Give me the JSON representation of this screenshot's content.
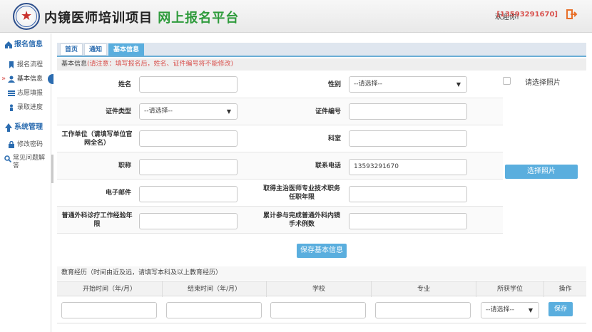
{
  "header": {
    "title_main": "内镜医师培训项目",
    "title_highlight": "网上报名平台",
    "welcome": "欢迎你!",
    "phone": "[13593291670]"
  },
  "sidebar": {
    "group1": "报名信息",
    "items1": [
      "报名流程",
      "基本信息",
      "志愿填报",
      "录取进度"
    ],
    "group2": "系统管理",
    "items2": [
      "修改密码",
      "常见问题解答"
    ]
  },
  "tabs": [
    "首页",
    "通知",
    "基本信息"
  ],
  "basic": {
    "heading": "基本信息",
    "note": "(请注意：填写报名后，姓名、证件编号将不能修改)",
    "name_label": "姓名",
    "gender_label": "性别",
    "gender_value": "--请选择--",
    "idtype_label": "证件类型",
    "idtype_value": "--请选择--",
    "idno_label": "证件编号",
    "unit_label": "工作单位（请填写单位官网全名）",
    "dept_label": "科室",
    "title_label": "职称",
    "phone_label": "联系电话",
    "phone_value": "13593291670",
    "email_label": "电子邮件",
    "years_label": "取得主治医师专业技术职务任职年限",
    "exp_label": "普通外科诊疗工作经验年限",
    "count_label": "累计参与完成普通外科内镜手术例数",
    "photo_check_label": "请选择照片",
    "photo_button": "选择照片",
    "save_button": "保存基本信息"
  },
  "education": {
    "heading": "教育经历（时间由近及远，请填写本科及以上教育经历）",
    "columns": [
      "开始时间（年/月）",
      "结束时间（年/月）",
      "学校",
      "专业",
      "所获学位",
      "操作"
    ],
    "degree_value": "--请选择--",
    "save_button": "保存"
  },
  "colors": {
    "accent": "#5aaede",
    "title_green": "#2e9b3b",
    "warning": "#d9534f"
  }
}
